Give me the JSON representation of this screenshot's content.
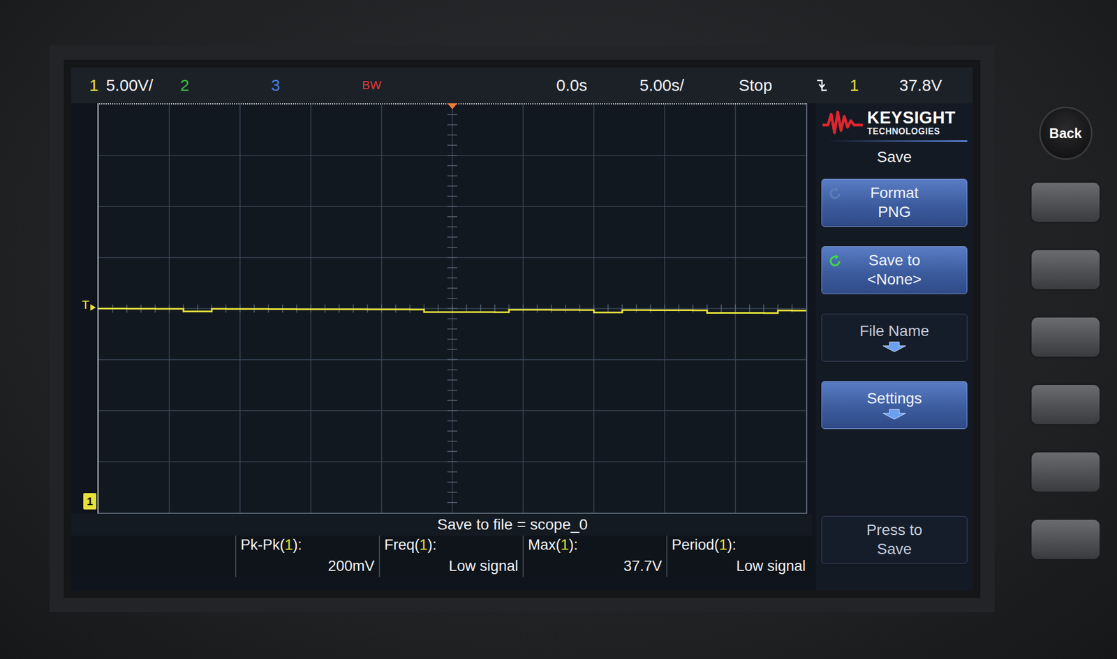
{
  "top_bar": {
    "channels": [
      {
        "label": "1",
        "scale": "5.00V/",
        "color": "#e8e03a"
      },
      {
        "label": "2",
        "scale": "",
        "color": "#3dbb3d"
      },
      {
        "label": "3",
        "scale": "",
        "color": "#4a7fe0"
      }
    ],
    "bw": "BW",
    "delay": "0.0s",
    "timebase": "5.00s/",
    "run_state": "Stop",
    "trigger": {
      "source": "1",
      "level": "37.8V"
    }
  },
  "graticule": {
    "trigger_marker": "T",
    "ground_marker": "1",
    "trace": {
      "channel": "1",
      "color": "#ece63a",
      "volts_per_div": 5,
      "values": [
        20.0,
        20.0,
        19.99,
        19.99,
        19.98,
        19.98,
        19.72,
        19.72,
        19.97,
        19.96,
        19.96,
        19.96,
        19.95,
        19.95,
        19.94,
        19.94,
        19.94,
        19.93,
        19.93,
        19.92,
        19.92,
        19.92,
        19.91,
        19.66,
        19.66,
        19.66,
        19.65,
        19.65,
        19.64,
        19.88,
        19.88,
        19.88,
        19.87,
        19.87,
        19.86,
        19.61,
        19.61,
        19.85,
        19.85,
        19.84,
        19.84,
        19.84,
        19.83,
        19.58,
        19.58,
        19.57,
        19.57,
        19.56,
        19.81,
        19.8
      ]
    }
  },
  "softkey_menu": {
    "brand": "KEYSIGHT",
    "brand_sub": "TECHNOLOGIES",
    "title": "Save",
    "softkeys": [
      {
        "kind": "cycle",
        "lines": [
          "Format",
          "PNG"
        ],
        "highlighted": true,
        "cycle_active": false
      },
      {
        "kind": "cycle",
        "lines": [
          "Save to",
          "<None>"
        ],
        "highlighted": true,
        "cycle_active": true
      },
      {
        "kind": "submenu",
        "lines": [
          "File Name"
        ],
        "highlighted": false,
        "cycle_active": false
      },
      {
        "kind": "submenu",
        "lines": [
          "Settings"
        ],
        "highlighted": true,
        "cycle_active": false
      },
      {
        "kind": "empty",
        "lines": [],
        "highlighted": false,
        "cycle_active": false
      },
      {
        "kind": "action",
        "lines": [
          "Press to",
          "Save"
        ],
        "highlighted": false,
        "cycle_active": false
      }
    ]
  },
  "save_status": "Save to file = scope_0",
  "measurements": [
    {
      "label_prefix": "Pk-Pk(",
      "source": "1",
      "label_suffix": "):",
      "value": "200mV"
    },
    {
      "label_prefix": "Freq(",
      "source": "1",
      "label_suffix": "):",
      "value": "Low signal"
    },
    {
      "label_prefix": "Max(",
      "source": "1",
      "label_suffix": "):",
      "value": "37.7V"
    },
    {
      "label_prefix": "Period(",
      "source": "1",
      "label_suffix": "):",
      "value": "Low signal"
    }
  ],
  "hardware": {
    "back_button": "Back",
    "softkey_buttons": 6
  }
}
